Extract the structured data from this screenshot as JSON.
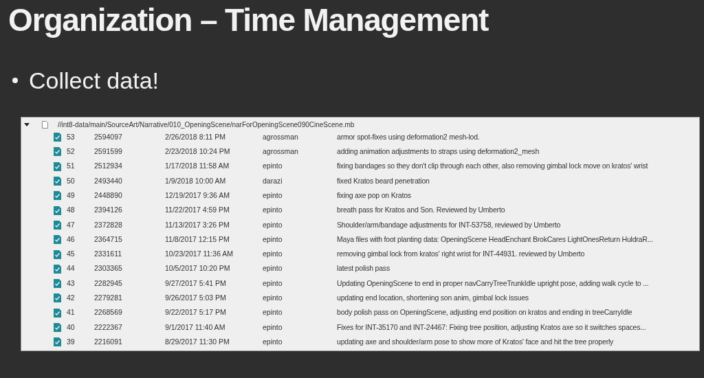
{
  "slide": {
    "title": "Organization – Time Management",
    "bullets": [
      "Collect data!"
    ]
  },
  "history": {
    "file": {
      "path": "//int8-data/main/SourceArt/Narrative/010_OpeningScene/narForOpeningScene090CineScene.mb",
      "expanded": true
    },
    "rows": [
      {
        "rev": "53",
        "change": "2594097",
        "date": "2/26/2018 8:11 PM",
        "user": "agrossman",
        "description": "armor spot-fixes using deformation2 mesh-lod."
      },
      {
        "rev": "52",
        "change": "2591599",
        "date": "2/23/2018 10:24 PM",
        "user": "agrossman",
        "description": "adding animation adjustments to straps using deformation2_mesh"
      },
      {
        "rev": "51",
        "change": "2512934",
        "date": "1/17/2018 11:58 AM",
        "user": "epinto",
        "description": "fixing bandages so they don't clip through each other, also removing gimbal lock move on kratos' wrist"
      },
      {
        "rev": "50",
        "change": "2493440",
        "date": "1/9/2018 10:00 AM",
        "user": "darazi",
        "description": "fixed Kratos beard penetration"
      },
      {
        "rev": "49",
        "change": "2448890",
        "date": "12/19/2017 9:36 AM",
        "user": "epinto",
        "description": "fixing axe pop on Kratos"
      },
      {
        "rev": "48",
        "change": "2394126",
        "date": "11/22/2017 4:59 PM",
        "user": "epinto",
        "description": "breath pass for Kratos and Son. Reviewed by Umberto"
      },
      {
        "rev": "47",
        "change": "2372828",
        "date": "11/13/2017 3:26 PM",
        "user": "epinto",
        "description": "Shoulder/arm/bandage adjustments for INT-53758, reviewed by Umberto"
      },
      {
        "rev": "46",
        "change": "2364715",
        "date": "11/8/2017 12:15 PM",
        "user": "epinto",
        "description": "Maya files with foot planting data: OpeningScene HeadEnchant BrokCares LightOnesReturn HuldraR..."
      },
      {
        "rev": "45",
        "change": "2331611",
        "date": "10/23/2017 11:36 AM",
        "user": "epinto",
        "description": "removing gimbal lock from kratos' right wrist for INT-44931. reviewed by Umberto"
      },
      {
        "rev": "44",
        "change": "2303365",
        "date": "10/5/2017 10:20 PM",
        "user": "epinto",
        "description": "latest polish pass"
      },
      {
        "rev": "43",
        "change": "2282945",
        "date": "9/27/2017 5:41 PM",
        "user": "epinto",
        "description": "Updating OpeningScene to end in proper navCarryTreeTrunkIdle upright pose, adding walk cycle to ..."
      },
      {
        "rev": "42",
        "change": "2279281",
        "date": "9/26/2017 5:03 PM",
        "user": "epinto",
        "description": "updating end location, shortening son anim, gimbal lock issues"
      },
      {
        "rev": "41",
        "change": "2268569",
        "date": "9/22/2017 5:17 PM",
        "user": "epinto",
        "description": "body polish pass on OpeningScene, adjusting end position on kratos and ending in treeCarryIdle"
      },
      {
        "rev": "40",
        "change": "2222367",
        "date": "9/1/2017 11:40 AM",
        "user": "epinto",
        "description": "Fixes for INT-35170 and INT-24467: Fixing tree position, adjusting Kratos axe so it switches spaces..."
      },
      {
        "rev": "39",
        "change": "2216091",
        "date": "8/29/2017 11:30 PM",
        "user": "epinto",
        "description": "updating axe and shoulder/arm pose to show more of Kratos' face and hit the tree properly"
      }
    ]
  }
}
